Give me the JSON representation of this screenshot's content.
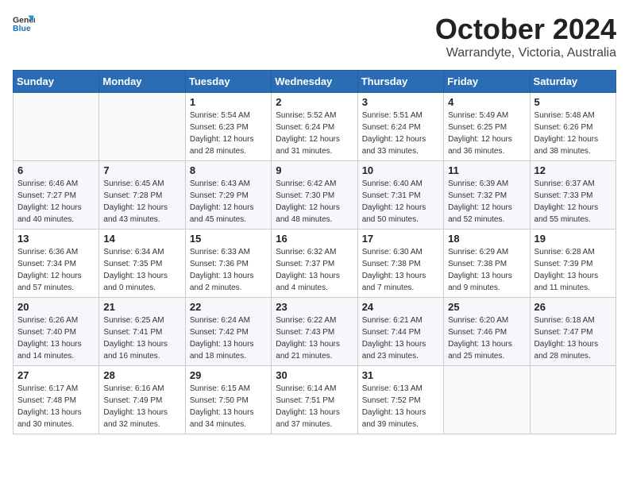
{
  "logo": {
    "line1": "General",
    "line2": "Blue"
  },
  "title": "October 2024",
  "subtitle": "Warrandyte, Victoria, Australia",
  "days_of_week": [
    "Sunday",
    "Monday",
    "Tuesday",
    "Wednesday",
    "Thursday",
    "Friday",
    "Saturday"
  ],
  "weeks": [
    [
      {
        "day": "",
        "info": ""
      },
      {
        "day": "",
        "info": ""
      },
      {
        "day": "1",
        "info": "Sunrise: 5:54 AM\nSunset: 6:23 PM\nDaylight: 12 hours and 28 minutes."
      },
      {
        "day": "2",
        "info": "Sunrise: 5:52 AM\nSunset: 6:24 PM\nDaylight: 12 hours and 31 minutes."
      },
      {
        "day": "3",
        "info": "Sunrise: 5:51 AM\nSunset: 6:24 PM\nDaylight: 12 hours and 33 minutes."
      },
      {
        "day": "4",
        "info": "Sunrise: 5:49 AM\nSunset: 6:25 PM\nDaylight: 12 hours and 36 minutes."
      },
      {
        "day": "5",
        "info": "Sunrise: 5:48 AM\nSunset: 6:26 PM\nDaylight: 12 hours and 38 minutes."
      }
    ],
    [
      {
        "day": "6",
        "info": "Sunrise: 6:46 AM\nSunset: 7:27 PM\nDaylight: 12 hours and 40 minutes."
      },
      {
        "day": "7",
        "info": "Sunrise: 6:45 AM\nSunset: 7:28 PM\nDaylight: 12 hours and 43 minutes."
      },
      {
        "day": "8",
        "info": "Sunrise: 6:43 AM\nSunset: 7:29 PM\nDaylight: 12 hours and 45 minutes."
      },
      {
        "day": "9",
        "info": "Sunrise: 6:42 AM\nSunset: 7:30 PM\nDaylight: 12 hours and 48 minutes."
      },
      {
        "day": "10",
        "info": "Sunrise: 6:40 AM\nSunset: 7:31 PM\nDaylight: 12 hours and 50 minutes."
      },
      {
        "day": "11",
        "info": "Sunrise: 6:39 AM\nSunset: 7:32 PM\nDaylight: 12 hours and 52 minutes."
      },
      {
        "day": "12",
        "info": "Sunrise: 6:37 AM\nSunset: 7:33 PM\nDaylight: 12 hours and 55 minutes."
      }
    ],
    [
      {
        "day": "13",
        "info": "Sunrise: 6:36 AM\nSunset: 7:34 PM\nDaylight: 12 hours and 57 minutes."
      },
      {
        "day": "14",
        "info": "Sunrise: 6:34 AM\nSunset: 7:35 PM\nDaylight: 13 hours and 0 minutes."
      },
      {
        "day": "15",
        "info": "Sunrise: 6:33 AM\nSunset: 7:36 PM\nDaylight: 13 hours and 2 minutes."
      },
      {
        "day": "16",
        "info": "Sunrise: 6:32 AM\nSunset: 7:37 PM\nDaylight: 13 hours and 4 minutes."
      },
      {
        "day": "17",
        "info": "Sunrise: 6:30 AM\nSunset: 7:38 PM\nDaylight: 13 hours and 7 minutes."
      },
      {
        "day": "18",
        "info": "Sunrise: 6:29 AM\nSunset: 7:38 PM\nDaylight: 13 hours and 9 minutes."
      },
      {
        "day": "19",
        "info": "Sunrise: 6:28 AM\nSunset: 7:39 PM\nDaylight: 13 hours and 11 minutes."
      }
    ],
    [
      {
        "day": "20",
        "info": "Sunrise: 6:26 AM\nSunset: 7:40 PM\nDaylight: 13 hours and 14 minutes."
      },
      {
        "day": "21",
        "info": "Sunrise: 6:25 AM\nSunset: 7:41 PM\nDaylight: 13 hours and 16 minutes."
      },
      {
        "day": "22",
        "info": "Sunrise: 6:24 AM\nSunset: 7:42 PM\nDaylight: 13 hours and 18 minutes."
      },
      {
        "day": "23",
        "info": "Sunrise: 6:22 AM\nSunset: 7:43 PM\nDaylight: 13 hours and 21 minutes."
      },
      {
        "day": "24",
        "info": "Sunrise: 6:21 AM\nSunset: 7:44 PM\nDaylight: 13 hours and 23 minutes."
      },
      {
        "day": "25",
        "info": "Sunrise: 6:20 AM\nSunset: 7:46 PM\nDaylight: 13 hours and 25 minutes."
      },
      {
        "day": "26",
        "info": "Sunrise: 6:18 AM\nSunset: 7:47 PM\nDaylight: 13 hours and 28 minutes."
      }
    ],
    [
      {
        "day": "27",
        "info": "Sunrise: 6:17 AM\nSunset: 7:48 PM\nDaylight: 13 hours and 30 minutes."
      },
      {
        "day": "28",
        "info": "Sunrise: 6:16 AM\nSunset: 7:49 PM\nDaylight: 13 hours and 32 minutes."
      },
      {
        "day": "29",
        "info": "Sunrise: 6:15 AM\nSunset: 7:50 PM\nDaylight: 13 hours and 34 minutes."
      },
      {
        "day": "30",
        "info": "Sunrise: 6:14 AM\nSunset: 7:51 PM\nDaylight: 13 hours and 37 minutes."
      },
      {
        "day": "31",
        "info": "Sunrise: 6:13 AM\nSunset: 7:52 PM\nDaylight: 13 hours and 39 minutes."
      },
      {
        "day": "",
        "info": ""
      },
      {
        "day": "",
        "info": ""
      }
    ]
  ]
}
